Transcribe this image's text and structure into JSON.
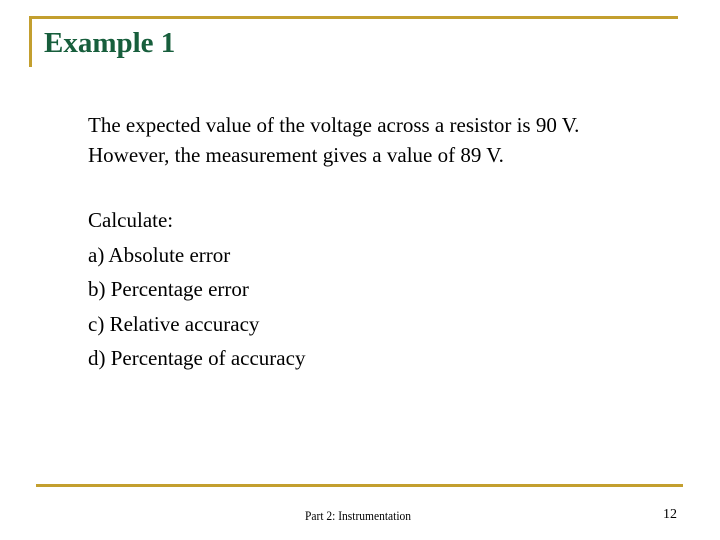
{
  "slide": {
    "title": "Example 1",
    "problem_lines": [
      "The expected value of the voltage across a resistor is 90 V.",
      "However, the measurement gives a value of 89 V."
    ],
    "calculate_heading": "Calculate:",
    "items": [
      "a) Absolute error",
      "b) Percentage error",
      "c) Relative accuracy",
      "d) Percentage of accuracy"
    ],
    "footer": "Part 2: Instrumentation",
    "page_number": "12"
  },
  "colors": {
    "accent_rule": "#C39F2F",
    "title": "#175E3C",
    "text": "#000000",
    "background": "#FFFFFF"
  }
}
